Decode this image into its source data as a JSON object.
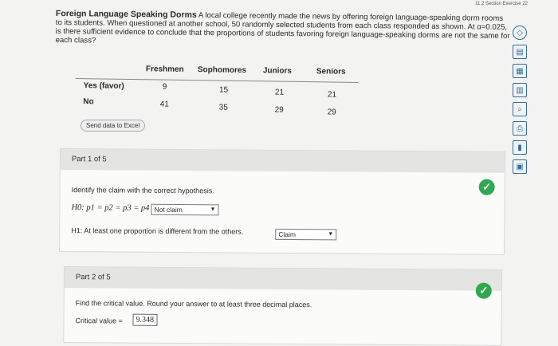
{
  "header": {
    "section_label": "11.2 Section Exercise 22"
  },
  "problem": {
    "title": "Foreign Language Speaking Dorms",
    "text": "A local college recently made the news by offering foreign language-speaking dorm rooms to its students. When questioned at another school, 50 randomly selected students from each class responded as shown. At α=0.025, is there sufficient evidence to conclude that the proportions of students favoring foreign language-speaking dorms are not the same for each class?"
  },
  "table": {
    "columns": [
      "Freshmen",
      "Sophomores",
      "Juniors",
      "Seniors"
    ],
    "rows": [
      {
        "label": "Yes (favor)",
        "values": [
          "9",
          "15",
          "21",
          "21"
        ]
      },
      {
        "label": "No",
        "values": [
          "41",
          "35",
          "29",
          "29"
        ]
      }
    ]
  },
  "excel_button": {
    "label": "Send data to Excel"
  },
  "part1": {
    "header": "Part 1 of 5",
    "instruction": "Identify the claim with the correct hypothesis.",
    "h0_label": "H0: p1 = p2 = p3 = p4",
    "h0_selected": "Not claim",
    "h1_label": "H1: At least one proportion is different from the others.",
    "h1_selected": "Claim"
  },
  "part2": {
    "header": "Part 2 of 5",
    "instruction": "Find the critical value. Round your answer to at least three decimal places.",
    "critical_label": "Critical value =",
    "critical_value": "9.348"
  },
  "icons": {
    "check": "checkmark-icon",
    "toolbar": [
      "diamond-icon",
      "calculator-icon",
      "grid-icon",
      "table-icon",
      "search-icon",
      "print-icon",
      "chart-icon",
      "tools-icon"
    ]
  },
  "colors": {
    "check_green": "#2fa84f",
    "toolbar_blue": "#2e6ea6"
  }
}
